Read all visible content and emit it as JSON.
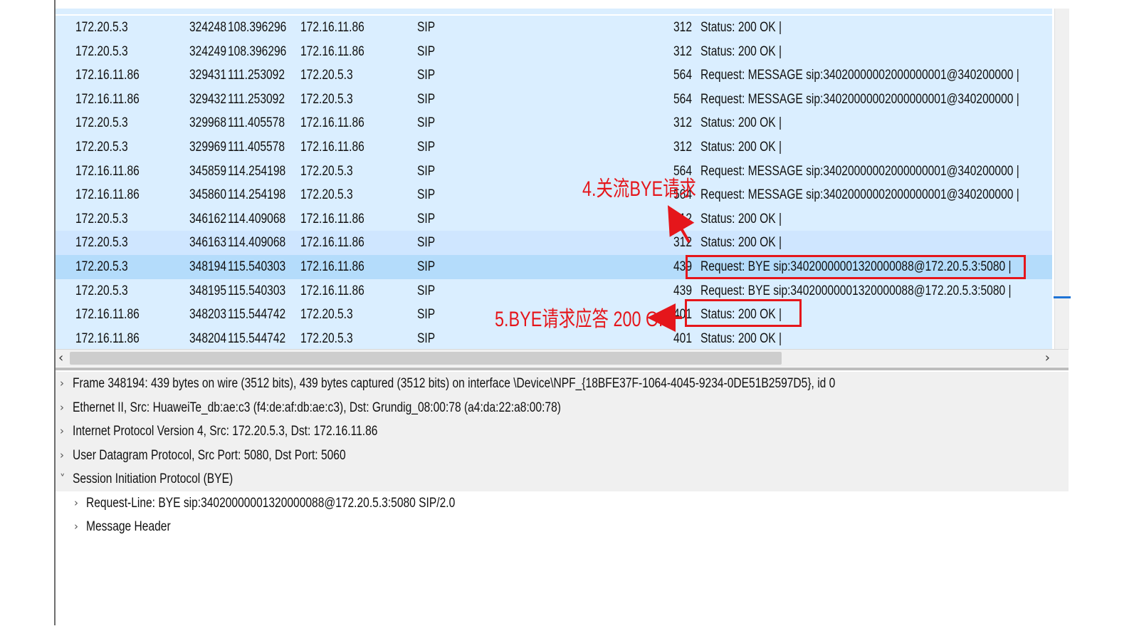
{
  "packets": [
    {
      "src": "172.20.5.3",
      "no": "324248",
      "time": "108.396296",
      "dst": "172.16.11.86",
      "proto": "SIP",
      "len": "312",
      "info": "Status: 200 OK |"
    },
    {
      "src": "172.20.5.3",
      "no": "324249",
      "time": "108.396296",
      "dst": "172.16.11.86",
      "proto": "SIP",
      "len": "312",
      "info": "Status: 200 OK |"
    },
    {
      "src": "172.16.11.86",
      "no": "329431",
      "time": "111.253092",
      "dst": "172.20.5.3",
      "proto": "SIP",
      "len": "564",
      "info": "Request: MESSAGE sip:34020000002000000001@340200000 |"
    },
    {
      "src": "172.16.11.86",
      "no": "329432",
      "time": "111.253092",
      "dst": "172.20.5.3",
      "proto": "SIP",
      "len": "564",
      "info": "Request: MESSAGE sip:34020000002000000001@340200000 |"
    },
    {
      "src": "172.20.5.3",
      "no": "329968",
      "time": "111.405578",
      "dst": "172.16.11.86",
      "proto": "SIP",
      "len": "312",
      "info": "Status: 200 OK |"
    },
    {
      "src": "172.20.5.3",
      "no": "329969",
      "time": "111.405578",
      "dst": "172.16.11.86",
      "proto": "SIP",
      "len": "312",
      "info": "Status: 200 OK |"
    },
    {
      "src": "172.16.11.86",
      "no": "345859",
      "time": "114.254198",
      "dst": "172.20.5.3",
      "proto": "SIP",
      "len": "564",
      "info": "Request: MESSAGE sip:34020000002000000001@340200000 |"
    },
    {
      "src": "172.16.11.86",
      "no": "345860",
      "time": "114.254198",
      "dst": "172.20.5.3",
      "proto": "SIP",
      "len": "564",
      "info": "Request: MESSAGE sip:34020000002000000001@340200000 |"
    },
    {
      "src": "172.20.5.3",
      "no": "346162",
      "time": "114.409068",
      "dst": "172.16.11.86",
      "proto": "SIP",
      "len": "312",
      "info": "Status: 200 OK |"
    },
    {
      "src": "172.20.5.3",
      "no": "346163",
      "time": "114.409068",
      "dst": "172.16.11.86",
      "proto": "SIP",
      "len": "312",
      "info": "Status: 200 OK |"
    },
    {
      "src": "172.20.5.3",
      "no": "348194",
      "time": "115.540303",
      "dst": "172.16.11.86",
      "proto": "SIP",
      "len": "439",
      "info": "Request: BYE sip:34020000001320000088@172.20.5.3:5080 |"
    },
    {
      "src": "172.20.5.3",
      "no": "348195",
      "time": "115.540303",
      "dst": "172.16.11.86",
      "proto": "SIP",
      "len": "439",
      "info": "Request: BYE sip:34020000001320000088@172.20.5.3:5080 |"
    },
    {
      "src": "172.16.11.86",
      "no": "348203",
      "time": "115.544742",
      "dst": "172.20.5.3",
      "proto": "SIP",
      "len": "401",
      "info": "Status: 200 OK |"
    },
    {
      "src": "172.16.11.86",
      "no": "348204",
      "time": "115.544742",
      "dst": "172.20.5.3",
      "proto": "SIP",
      "len": "401",
      "info": "Status: 200 OK |"
    }
  ],
  "details": [
    {
      "text": "Frame 348194: 439 bytes on wire (3512 bits), 439 bytes captured (3512 bits) on interface \\Device\\NPF_{18BFE37F-1064-4045-9234-0DE51B2597D5}, id 0",
      "twisty": "›"
    },
    {
      "text": "Ethernet II, Src: HuaweiTe_db:ae:c3 (f4:de:af:db:ae:c3), Dst: Grundig_08:00:78 (a4:da:22:a8:00:78)",
      "twisty": "›"
    },
    {
      "text": "Internet Protocol Version 4, Src: 172.20.5.3, Dst: 172.16.11.86",
      "twisty": "›"
    },
    {
      "text": "User Datagram Protocol, Src Port: 5080, Dst Port: 5060",
      "twisty": "›"
    },
    {
      "text": "Session Initiation Protocol (BYE)",
      "twisty": "˅"
    }
  ],
  "sip_children": [
    {
      "text": "Request-Line: BYE sip:34020000001320000088@172.20.5.3:5080 SIP/2.0",
      "twisty": "›"
    },
    {
      "text": "Message Header",
      "twisty": "›"
    }
  ],
  "annotations": {
    "step4": "4.关流BYE请求",
    "step5": "5.BYE请求应答 200 OK"
  },
  "scroll": {
    "left_arrow": "‹",
    "right_arrow": "›"
  },
  "colors": {
    "row_bg": "#daeeff",
    "selected_bg": "#b4dcfb",
    "annotation_red": "#e5161b"
  }
}
